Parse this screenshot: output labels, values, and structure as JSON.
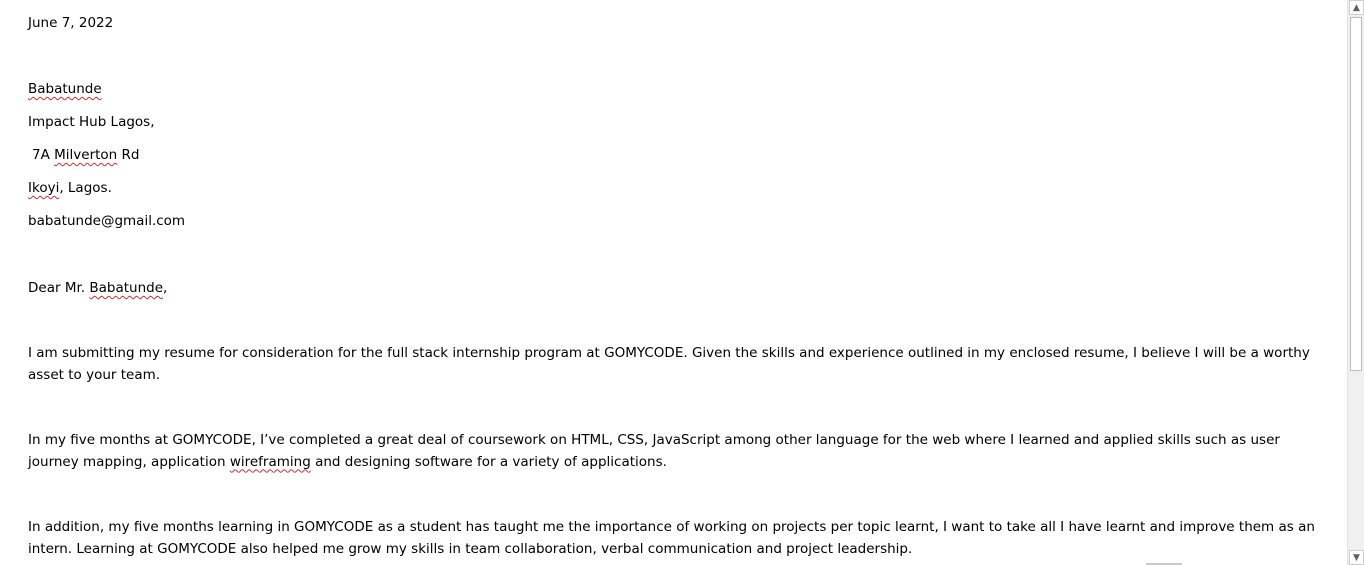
{
  "letter": {
    "date": "June 7, 2022",
    "recipient_name": "Babatunde",
    "address_line1": "Impact Hub Lagos,",
    "address_line2_prefix": "7A ",
    "address_line2_street": "Milverton",
    "address_line2_suffix": " Rd",
    "address_line3_city": "Ikoyi",
    "address_line3_rest": ", Lagos.",
    "email": "babatunde@gmail.com",
    "salutation_prefix": "Dear Mr. ",
    "salutation_name": "Babatunde",
    "salutation_suffix": ",",
    "paragraph1": "I am submitting my resume for consideration for the full stack internship program at GOMYCODE. Given the skills and experience outlined in my enclosed resume, I believe I will be a worthy asset to your team.",
    "paragraph2_before": "In my five months at GOMYCODE, I’ve completed a great deal of coursework on HTML, CSS, JavaScript among other language for the web where I learned and applied skills such as user journey mapping, application ",
    "paragraph2_flagged": "wireframing",
    "paragraph2_after": " and designing software for a variety of applications.",
    "paragraph3": "In addition, my five months learning in GOMYCODE as a student has taught me the importance of working on projects per topic learnt, I want to take all I have learnt and improve them as an intern. Learning at GOMYCODE also helped me grow my skills in team collaboration, verbal communication and project leadership."
  },
  "scrollbar": {
    "up_icon": "▲",
    "down_icon": "▼"
  },
  "colors": {
    "spellcheck_underline": "#d32f2f",
    "page_background": "#ffffff",
    "text": "#000000"
  }
}
